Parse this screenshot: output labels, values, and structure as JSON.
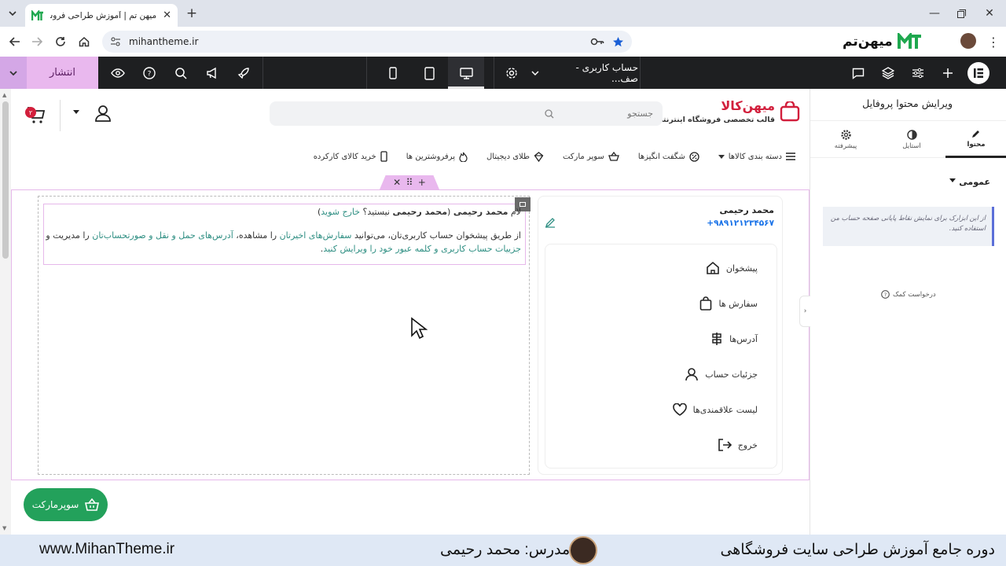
{
  "browser": {
    "tab_title": "میهن تم | آموزش طراحی فروشگاه",
    "url": "mihantheme.ir",
    "extension_brand": "میهن‌تم"
  },
  "editor_toolbar": {
    "publish_label": "انتشار",
    "document_name": "حساب کاربری - صف..."
  },
  "site": {
    "logo_name": "میهن‌کالا",
    "logo_tagline": "قالب تخصصی فروشگاه اینترنتی",
    "search_placeholder": "جستجو",
    "cart_count": "۲",
    "categories": [
      {
        "label": "دسته بندی کالاها",
        "icon": "menu-icon"
      },
      {
        "label": "شگفت انگیزها",
        "icon": "discount-icon"
      },
      {
        "label": "سوپر مارکت",
        "icon": "basket-icon"
      },
      {
        "label": "طلای دیجیتال",
        "icon": "gold-icon"
      },
      {
        "label": "پرفروشترین ها",
        "icon": "fire-icon"
      },
      {
        "label": "خرید کالای کارکرده",
        "icon": "phone-icon"
      }
    ]
  },
  "profile": {
    "name": "محمد رحیمی",
    "phone": "+۹۸۹۱۲۱۲۳۴۵۶۷",
    "menu": [
      {
        "label": "پیشخوان",
        "icon": "home-icon"
      },
      {
        "label": "سفارش ها",
        "icon": "bag-icon"
      },
      {
        "label": "آدرس‌ها",
        "icon": "signpost-icon"
      },
      {
        "label": "جزئیات حساب",
        "icon": "user-icon"
      },
      {
        "label": "لیست علاقمندی‌ها",
        "icon": "heart-icon"
      },
      {
        "label": "خروج",
        "icon": "logout-icon"
      }
    ]
  },
  "dashboard": {
    "greet_prefix": "لام",
    "greet_name": "محمد رحیمی",
    "greet_mid_open": " (",
    "greet_name2": "محمد رحیمی",
    "greet_question": " نیستید؟ ",
    "logout_link": "خارج شوید",
    "greet_close": ")",
    "p2_a": "از طریق پیشخوان حساب کاربری‌تان، می‌توانید ",
    "p2_link1": "سفارش‌های اخیرتان",
    "p2_b": " را مشاهده، ",
    "p2_link2": "آدرس‌های حمل و نقل و صورتحساب‌تان",
    "p2_c": " را مدیریت و",
    "p3_link": "جزییات حساب کاربری و کلمه عبور خود را ویرایش کنید",
    "p3_end": "."
  },
  "fab_label": "سوپرمارکت",
  "panel": {
    "title": "ویرایش محتوا پروفایل",
    "tabs": [
      {
        "label": "محتوا",
        "icon": "pencil-icon"
      },
      {
        "label": "استایل",
        "icon": "contrast-icon"
      },
      {
        "label": "پیشرفته",
        "icon": "gear-icon"
      }
    ],
    "section": "عمومی",
    "info": "از این ابزارک برای نمایش نقاط پایانی صفحه حساب من استفاده کنید.",
    "help": "درخواست کمک"
  },
  "footer": {
    "site": "www.MihanTheme.ir",
    "teacher": "مدرس: محمد رحیمی",
    "course": "دوره جامع آموزش طراحی سایت فروشگاهی"
  },
  "colors": {
    "publish_bg": "#e9b8ee",
    "toolbar_bg": "#1e1f21",
    "link_teal": "#2f8f83",
    "brand_red": "#d21f3c",
    "fab_green": "#23a15b",
    "footer_bg": "#dfe8f5"
  }
}
